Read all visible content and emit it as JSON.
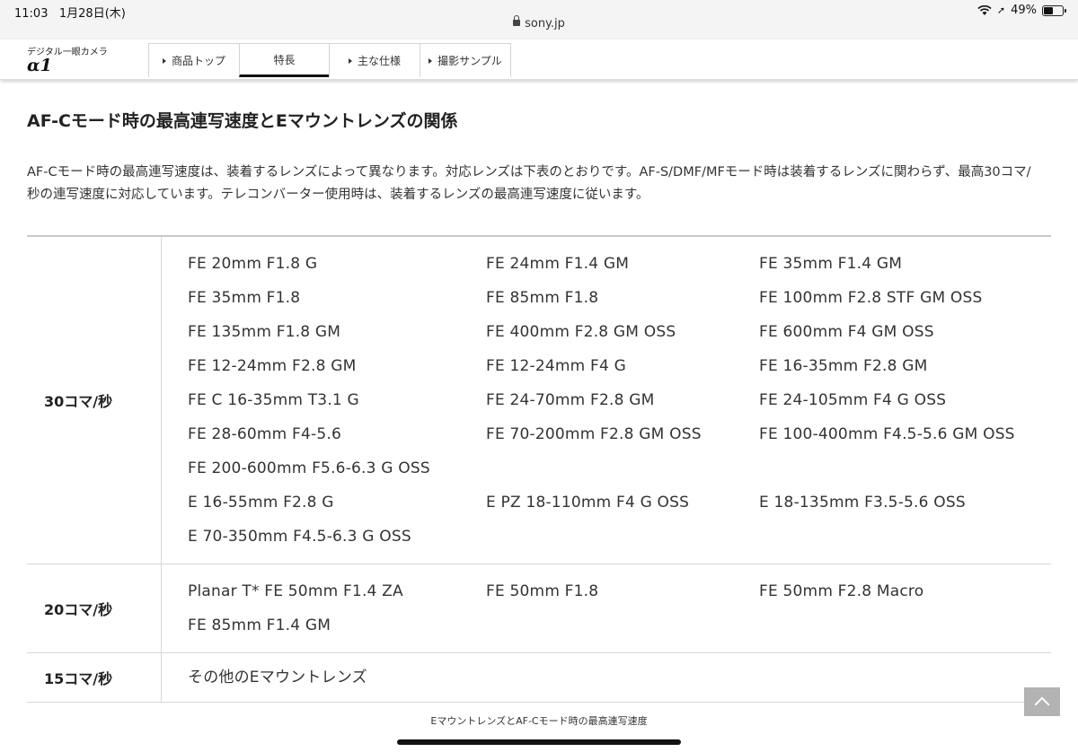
{
  "status_bar": {
    "time": "11:03",
    "date": "1月28日(木)",
    "url": "sony.jp",
    "battery": "49%",
    "battery_level": 0.49
  },
  "product_nav": {
    "subtitle": "デジタル一眼カメラ",
    "product": "α1",
    "tabs": [
      {
        "label": "商品トップ",
        "arrow": true,
        "active": false
      },
      {
        "label": "特長",
        "arrow": false,
        "active": true
      },
      {
        "label": "主な仕様",
        "arrow": true,
        "active": false
      },
      {
        "label": "撮影サンプル",
        "arrow": true,
        "active": false
      }
    ]
  },
  "section": {
    "heading": "AF-Cモード時の最高連写速度とEマウントレンズの関係",
    "intro": "AF-Cモード時の最高連写速度は、装着するレンズによって異なります。対応レンズは下表のとおりです。AF-S/DMF/MFモード時は装着するレンズに関わらず、最高30コマ/秒の連写速度に対応しています。テレコンバーター使用時は、装着するレンズの最高連写速度に従います。"
  },
  "table": {
    "rows": [
      {
        "label": "30コマ/秒",
        "lenses": [
          "FE 20mm F1.8 G",
          "FE 24mm F1.4 GM",
          "FE 35mm F1.4 GM",
          "FE 35mm F1.8",
          "FE 85mm F1.8",
          "FE 100mm F2.8 STF GM OSS",
          "FE 135mm F1.8 GM",
          "FE 400mm F2.8 GM OSS",
          "FE 600mm F4 GM OSS",
          "FE 12-24mm F2.8 GM",
          "FE 12-24mm F4 G",
          "FE 16-35mm F2.8 GM",
          "FE C 16-35mm T3.1 G",
          "FE 24-70mm F2.8 GM",
          "FE 24-105mm F4 G OSS",
          "FE 28-60mm F4-5.6",
          "FE 70-200mm F2.8 GM OSS",
          "FE 100-400mm F4.5-5.6 GM OSS",
          "FE 200-600mm F5.6-6.3 G OSS",
          "",
          "",
          "E 16-55mm F2.8 G",
          "E PZ 18-110mm F4 G OSS",
          "E 18-135mm F3.5-5.6 OSS",
          "E 70-350mm F4.5-6.3 G OSS",
          "",
          ""
        ]
      },
      {
        "label": "20コマ/秒",
        "lenses": [
          "Planar T* FE 50mm F1.4 ZA",
          "FE 50mm F1.8",
          "FE 50mm F2.8 Macro",
          "FE 85mm F1.4 GM",
          "",
          ""
        ]
      },
      {
        "label": "15コマ/秒",
        "lenses": [
          "その他のEマウントレンズ",
          "",
          ""
        ]
      }
    ],
    "caption": "EマウントレンズとAF-Cモード時の最高連写速度"
  }
}
